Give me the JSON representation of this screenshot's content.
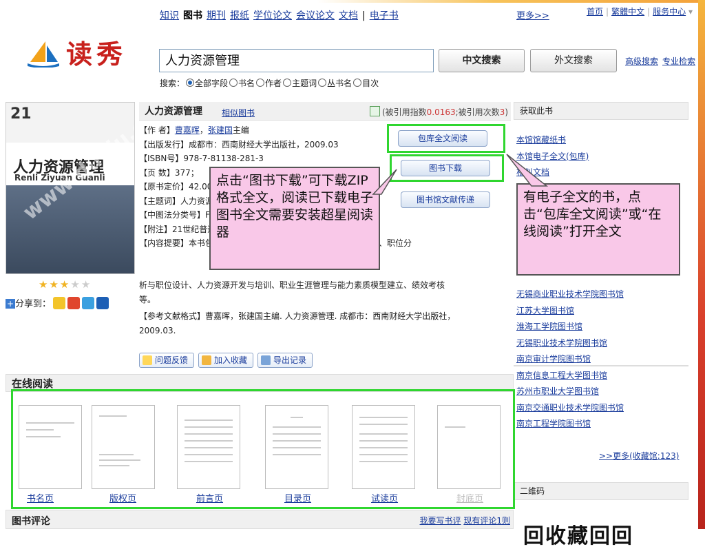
{
  "header": {
    "top_links": [
      "首页",
      "繁體中文",
      "服务中心"
    ],
    "nav": {
      "items": [
        "知识",
        "图书",
        "期刊",
        "报纸",
        "学位论文",
        "会议论文",
        "文档",
        "电子书"
      ],
      "more": "更多>>"
    },
    "logo_text": "读秀"
  },
  "search": {
    "value": "人力资源管理",
    "btn_cn": "中文搜索",
    "btn_foreign": "外文搜索",
    "adv_links": [
      "高级搜索",
      "专业检索"
    ],
    "scope_label": "搜索：",
    "scopes": [
      "全部字段",
      "书名",
      "作者",
      "主题词",
      "丛书名",
      "目次"
    ],
    "selected_scope": "全部字段"
  },
  "cover": {
    "series_no": "21",
    "title": "人力资源管理",
    "pinyin": "Renli Ziyuan Guanli",
    "watermark": "www.duxiu.com"
  },
  "rating": {
    "stars": 3,
    "max": 5
  },
  "share": {
    "label": "分享到："
  },
  "book": {
    "title": "人力资源管理",
    "similar": "相似图书",
    "cite_prefix": "(被引用指数",
    "cite_index": "0.0163",
    "cite_mid": ";被引用次数",
    "cite_count": "3",
    "cite_suffix": ")",
    "author_label": "【作 者】",
    "authors": [
      "曹嘉晖",
      "张建国"
    ],
    "author_suffix": "主编",
    "publish": "【出版发行】成都市：西南财经大学出版社，2009.03",
    "isbn": "【ISBN号】978-7-81138-281-3",
    "pages": "【页 数】377；",
    "price": "【原书定价】42.00",
    "subject": "【主题词】人力资源-资源管理",
    "class": "【中图法分类号】F241（经济->劳动经济->劳动力）",
    "note": "【附注】21世纪普通高等院校系列规划教材",
    "summary_1": "【内容提要】本书包括：人力资源管理概况、人力资源战略与规划、职位分",
    "summary_2": "析与职位设计、人力资源开发与培训、职业生涯管理与能力素质模型建立、绩效考核",
    "summary_3": "等。",
    "ref_1": "【参考文献格式】曹嘉晖，张建国主编. 人力资源管理. 成都市：西南财经大学出版社，",
    "ref_2": "2009.03.",
    "actions": [
      "问题反馈",
      "加入收藏",
      "导出记录"
    ]
  },
  "buttons": {
    "read_full": "包库全文阅读",
    "download": "图书下载",
    "delivery": "图书馆文献传递"
  },
  "callouts": {
    "download_tip": "点击“图书下载”可下载ZIP格式全文，阅读已下载电子图书全文需要安装超星阅读器",
    "read_tip": "有电子全文的书，点击“包库全文阅读”或“在线阅读”打开全文"
  },
  "right_panel": {
    "get_title": "获取此书",
    "get_links": [
      "本馆馆藏纸书",
      "本馆电子全文(包库)",
      "相似文档"
    ],
    "libraries": [
      "无锡商业职业技术学院图书馆",
      "江苏大学图书馆",
      "淮海工学院图书馆",
      "无锡职业技术学院图书馆",
      "南京审计学院图书馆",
      "南京信息工程大学图书馆",
      "苏州市职业大学图书馆",
      "南京交通职业技术学院图书馆",
      "南京工程学院图书馆"
    ],
    "more": ">>更多(收藏馆:123)",
    "qr_title": "二维码",
    "qr_text": "回收藏回回"
  },
  "reading": {
    "title": "在线阅读",
    "pages": [
      "书名页",
      "版权页",
      "前言页",
      "目录页",
      "试读页",
      "封底页"
    ]
  },
  "reviews": {
    "title": "图书评论",
    "write": "我要写书评",
    "existing": "现有评论1则"
  }
}
